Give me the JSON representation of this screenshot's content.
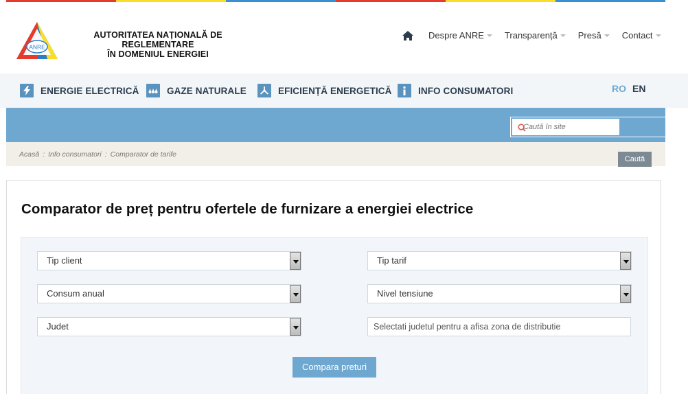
{
  "brand": {
    "logo_text": "ANRE",
    "org_line1": "AUTORITATEA NAȚIONALĂ DE REGLEMENTARE",
    "org_line2": "ÎN DOMENIUL ENERGIEI",
    "stripe_colors": [
      "#e53b2c",
      "#f8dd2b",
      "#3a8fd0",
      "#e53b2c",
      "#f8dd2b",
      "#3a8fd0"
    ]
  },
  "top_nav": {
    "home_icon": "home-icon",
    "items": [
      {
        "label": "Despre ANRE"
      },
      {
        "label": "Transparență"
      },
      {
        "label": "Presă"
      },
      {
        "label": "Contact"
      }
    ]
  },
  "main_nav": {
    "items": [
      {
        "label": "ENERGIE ELECTRICĂ",
        "icon": "lightning-icon"
      },
      {
        "label": "GAZE NATURALE",
        "icon": "gas-drops-icon"
      },
      {
        "label": "EFICIENȚĂ ENERGETICĂ",
        "icon": "fan-icon"
      },
      {
        "label": "INFO CONSUMATORI",
        "icon": "info-icon"
      }
    ],
    "languages": [
      {
        "code": "RO",
        "color": "#6ea8d1"
      },
      {
        "code": "EN",
        "color": "#2b3c4d"
      }
    ]
  },
  "search": {
    "placeholder": "Caută în site",
    "button_label": "Caută"
  },
  "breadcrumb": {
    "items": [
      "Acasă",
      "Info consumatori",
      "Comparator de tarife"
    ],
    "separator": ":"
  },
  "page": {
    "title": "Comparator de preț pentru ofertele de furnizare a energiei electrice"
  },
  "form": {
    "tip_client": "Tip client",
    "tip_tarif": "Tip tarif",
    "consum_anual": "Consum anual",
    "nivel_tensiune": "Nivel tensiune",
    "judet": "Judet",
    "zona_placeholder": "Selectati judetul pentru a afisa zona de distributie",
    "submit_label": "Compara preturi"
  },
  "colors": {
    "accent": "#6ea8d1",
    "nav_bg": "#f3f6f9",
    "crumb_bg": "#f1efe7",
    "dark_text": "#2b3c4d"
  }
}
